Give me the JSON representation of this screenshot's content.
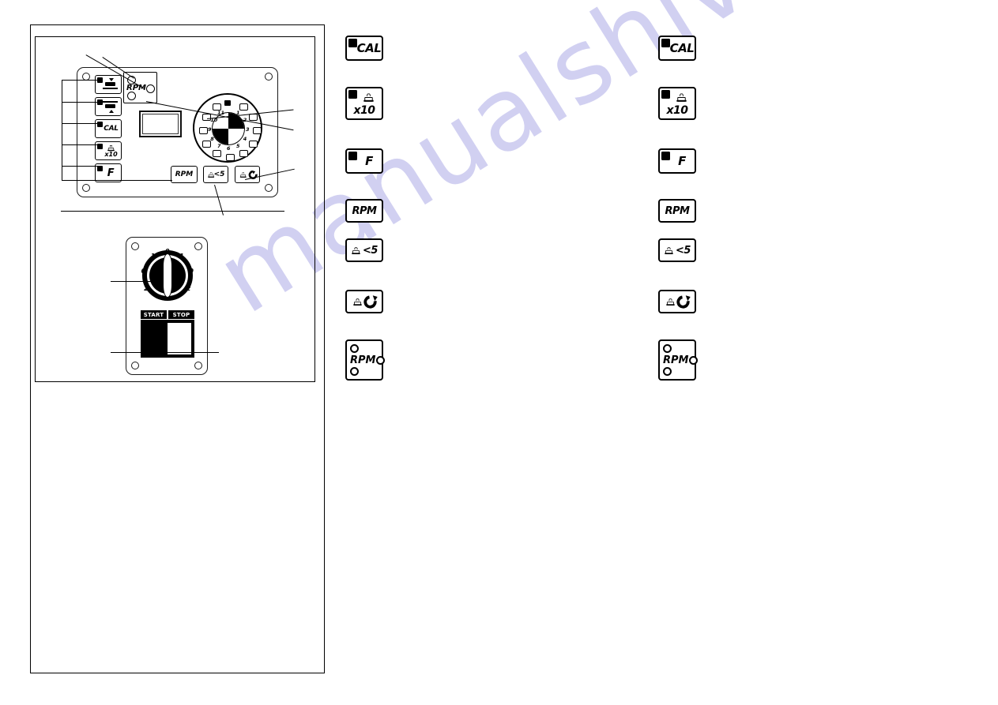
{
  "watermark": {
    "text": "manualshive.com",
    "color": "#c9c8ef"
  },
  "diagram": {
    "top_panel": {
      "name": "control-panel-keypad",
      "keys": [
        {
          "id": "wheel-down",
          "label": "",
          "icon": "wheel-position-down-icon",
          "has_led": true
        },
        {
          "id": "wheel-up",
          "label": "",
          "icon": "wheel-position-up-icon",
          "has_led": true
        },
        {
          "id": "cal",
          "label": "CAL",
          "icon": "",
          "has_led": true
        },
        {
          "id": "x10",
          "label": "x10",
          "icon": "weight-mass-icon",
          "has_led": true
        },
        {
          "id": "f",
          "label": "F",
          "icon": "",
          "has_led": true
        }
      ],
      "rpm_indicator": {
        "label": "RPM",
        "led_count": 3
      },
      "display": {
        "label": "",
        "value": ""
      },
      "dial": {
        "name": "balance-position-dial",
        "numbers": [
          "1",
          "2",
          "3",
          "4",
          "5",
          "6",
          "7",
          "8",
          "9",
          "10",
          "11"
        ],
        "top_marker": true,
        "hub_pattern": "two-tone-quadrants"
      },
      "bottom_keys": [
        {
          "id": "rpm",
          "label": "RPM",
          "icon": ""
        },
        {
          "id": "weight-lt-5",
          "label": "<5",
          "icon": "weight-mass-icon"
        },
        {
          "id": "weight-rotate",
          "label": "",
          "icon": "weight-rotation-icon"
        }
      ]
    },
    "bottom_panel": {
      "name": "power-switch-panel",
      "knob": {
        "name": "main-rotary-switch",
        "numbers": [
          "0",
          "1",
          "2",
          "0",
          "1",
          "2",
          "0"
        ]
      },
      "start_label": "START",
      "stop_label": "STOP"
    }
  },
  "legend": {
    "left_column": [
      {
        "id": "cal",
        "type": "led-key",
        "label": "CAL"
      },
      {
        "id": "x10",
        "type": "led-key-stacked",
        "label": "x10",
        "icon": "weight-mass-icon"
      },
      {
        "id": "f",
        "type": "led-key",
        "label": "F"
      },
      {
        "id": "rpm",
        "type": "plain-key",
        "label": "RPM"
      },
      {
        "id": "weight-lt-5",
        "type": "icon-key",
        "label": "<5",
        "icon": "weight-mass-icon"
      },
      {
        "id": "weight-rotate",
        "type": "icon-key",
        "label": "",
        "icon": "weight-rotation-icon"
      },
      {
        "id": "rpm-leds",
        "type": "led-indicator",
        "label": "RPM",
        "led_count": 3
      }
    ],
    "right_column": [
      {
        "id": "cal",
        "type": "led-key",
        "label": "CAL"
      },
      {
        "id": "x10",
        "type": "led-key-stacked",
        "label": "x10",
        "icon": "weight-mass-icon"
      },
      {
        "id": "f",
        "type": "led-key",
        "label": "F"
      },
      {
        "id": "rpm",
        "type": "plain-key",
        "label": "RPM"
      },
      {
        "id": "weight-lt-5",
        "type": "icon-key",
        "label": "<5",
        "icon": "weight-mass-icon"
      },
      {
        "id": "weight-rotate",
        "type": "icon-key",
        "label": "",
        "icon": "weight-rotation-icon"
      },
      {
        "id": "rpm-leds",
        "type": "led-indicator",
        "label": "RPM",
        "led_count": 3
      }
    ]
  }
}
